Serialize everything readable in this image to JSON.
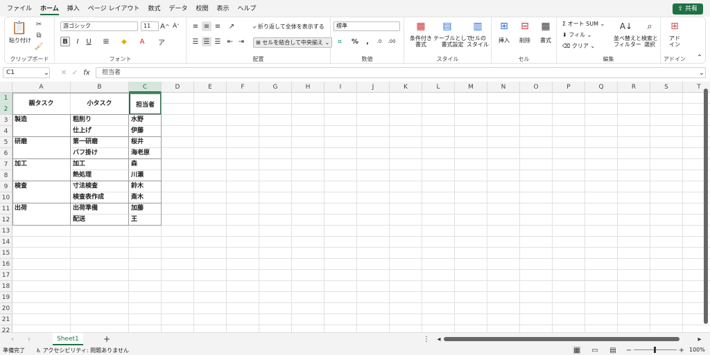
{
  "menu": {
    "tabs": [
      "ファイル",
      "ホーム",
      "挿入",
      "ページ レイアウト",
      "数式",
      "データ",
      "校閲",
      "表示",
      "ヘルプ"
    ],
    "share": "共有"
  },
  "ribbon": {
    "clipboard": {
      "paste": "貼り付け",
      "label": "クリップボード"
    },
    "font": {
      "name": "游ゴシック",
      "size": "11",
      "label": "フォント"
    },
    "alignment": {
      "wrap": "折り返して全体を表示する",
      "merge": "セルを結合して中央揃え",
      "label": "配置"
    },
    "number": {
      "format": "標準",
      "label": "数値"
    },
    "styles": {
      "conditional": "条件付き\n書式",
      "table": "テーブルとして\n書式設定",
      "cellstyle": "セルの\nスタイル",
      "label": "スタイル"
    },
    "cells": {
      "insert": "挿入",
      "delete": "削除",
      "format": "書式",
      "label": "セル"
    },
    "editing": {
      "autosum": "オート SUM",
      "fill": "フィル",
      "clear": "クリア",
      "sort": "並べ替えと\nフィルター",
      "find": "検索と\n選択",
      "label": "編集"
    },
    "addins": {
      "addin": "アド\nイン",
      "label": "アドイン"
    }
  },
  "formula": {
    "namebox": "C1",
    "value": "担当者"
  },
  "columns": [
    "A",
    "B",
    "C",
    "D",
    "E",
    "F",
    "G",
    "H",
    "I",
    "J",
    "K",
    "L",
    "M",
    "N",
    "O",
    "P",
    "Q",
    "R",
    "S",
    "T"
  ],
  "rows": [
    [
      "親タスク",
      "小タスク",
      "担当者"
    ],
    [
      "製造",
      "粗削り",
      "水野"
    ],
    [
      "",
      "仕上げ",
      "伊藤"
    ],
    [
      "研磨",
      "第一研磨",
      "桜井"
    ],
    [
      "",
      "バフ掛け",
      "海老原"
    ],
    [
      "加工",
      "加工",
      "森"
    ],
    [
      "",
      "熱処理",
      "川瀬"
    ],
    [
      "検査",
      "寸法検査",
      "鈴木"
    ],
    [
      "",
      "検査表作成",
      "斎木"
    ],
    [
      "出荷",
      "出荷準備",
      "加藤"
    ],
    [
      "",
      "配送",
      "王"
    ]
  ],
  "sheet": {
    "tab": "Sheet1"
  },
  "status": {
    "ready": "準備完了",
    "accessibility": "アクセシビリティ: 問題ありません",
    "zoom": "100%"
  }
}
